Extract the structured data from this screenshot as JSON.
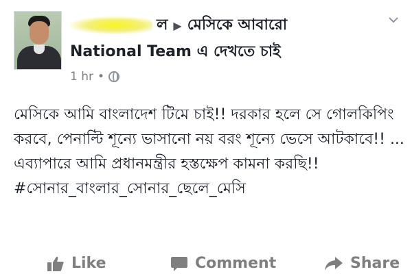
{
  "post": {
    "author_name_visible": "ল",
    "target_line_1": "মেসিকে আবারো",
    "target_line_2": "National Team এ দেখতে চাই",
    "time": "1 hr",
    "separator": "•",
    "body": "মেসিকে আমি বাংলাদেশ টিমে চাই!! দরকার হলে সে গোলকিপিং করবে, পেনাল্টি শূন্যে ভাসানো নয় বরং শূন্যে ভেসে আটকাবে!! ... এব্যাপারে আমি প্রধানমন্ত্রীর হস্তক্ষেপ কামনা করছি!!",
    "hashtag": "#সোনার_বাংলার_সোনার_ছেলে_মেসি"
  },
  "actions": {
    "like": "Like",
    "comment": "Comment",
    "share": "Share"
  },
  "icons": {
    "menu": "chevron-down-icon",
    "audience": "globe-icon",
    "like": "thumbs-up-icon",
    "comment": "comment-bubble-icon",
    "share": "share-arrow-icon"
  }
}
